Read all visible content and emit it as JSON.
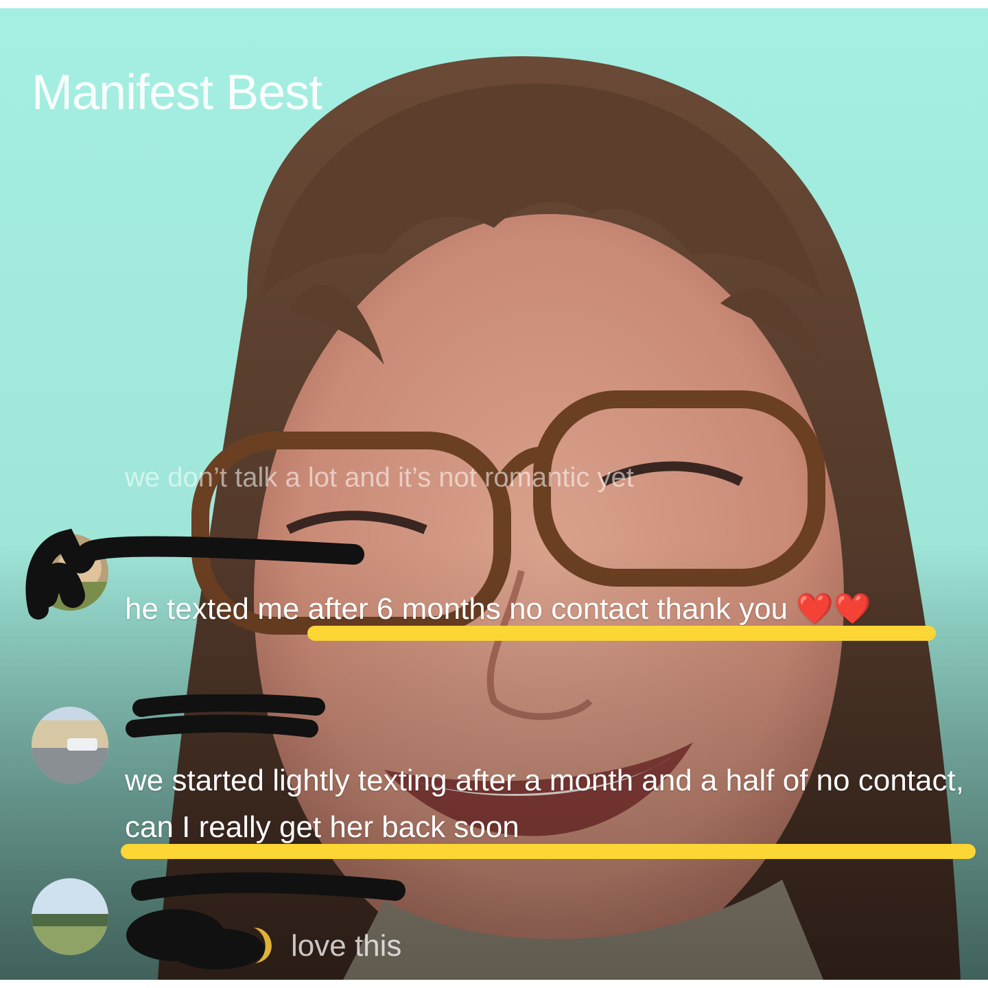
{
  "header": {
    "title": "Manifest Best"
  },
  "video": {
    "faded_caption": "we don’t talk a lot and it’s not romantic yet"
  },
  "comments": [
    {
      "text": "he texted me after 6 months no contact thank you",
      "emoji": "❤️❤️"
    },
    {
      "text": "we started lightly texting after a month and a half of no contact, can I really get her back soon"
    },
    {
      "text": "love this"
    }
  ],
  "colors": {
    "background": "#a4efe2",
    "highlight": "#fbd634",
    "redaction": "#111111"
  },
  "icons": [
    "heart-emoji",
    "moon-emoji"
  ]
}
